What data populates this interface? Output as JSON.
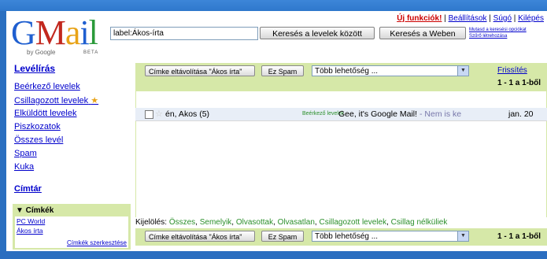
{
  "header": {
    "links": [
      "Új funkciók!",
      "Beállítások",
      "Súgó",
      "Kilépés"
    ],
    "search_value": "label:Ákos-írta",
    "search_mail_button": "Keresés a levelek között",
    "search_web_button": "Keresés a Weben",
    "search_options": [
      "Mutasd a keresési opciókat",
      "Szűrő létrehozása"
    ]
  },
  "logo": {
    "text": "Gmail",
    "by": "by Google",
    "beta": "BETA"
  },
  "nav": {
    "compose": "Levélírás",
    "items": [
      "Beérkező levelek",
      "Csillagozott levelek",
      "Elküldött levelek",
      "Piszkozatok",
      "Összes levél",
      "Spam",
      "Kuka"
    ],
    "contacts": "Címtár",
    "labels_title": "▼ Címkék",
    "labels": [
      "PC World",
      "Ákos írta"
    ],
    "labels_edit": "Címkék szerkesztése"
  },
  "toolbar": {
    "remove_label": "Címke eltávolítása \"Ákos írta\"",
    "spam": "Ez Spam",
    "more_actions": "Több lehetőség ...",
    "refresh": "Frissítés",
    "count": "1 - 1 a 1-ből"
  },
  "select": {
    "prefix": "Kijelölés:",
    "options": [
      "Összes",
      "Semelyik",
      "Olvasottak",
      "Olvasatlan",
      "Csillagozott levelek",
      "Csillag nélküliek"
    ]
  },
  "messages": [
    {
      "sender": "én, Akos (5)",
      "label": "Beérkező levelek",
      "subject": "Gee, it's Google Mail!",
      "snippet": " - Nem is ke",
      "date": "jan. 20"
    }
  ],
  "colors": {
    "accent": "#d6e8a8",
    "link": "#0000cc",
    "brand_red": "#c2281e"
  }
}
